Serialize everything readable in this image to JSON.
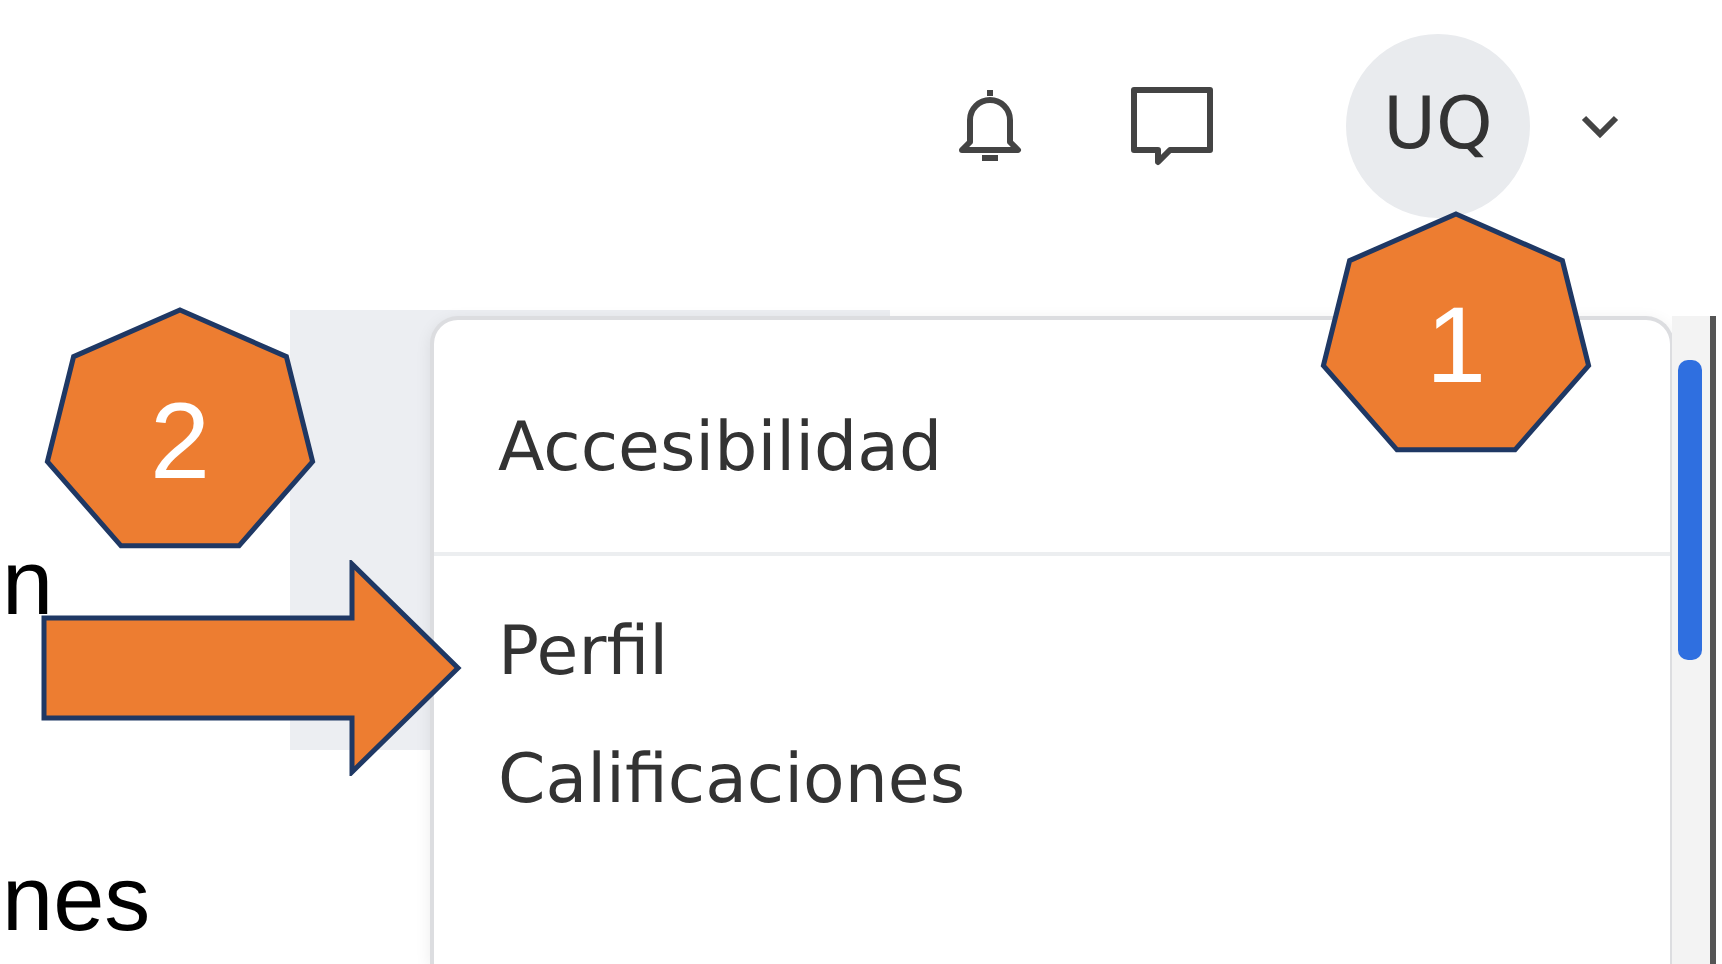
{
  "header": {
    "avatar_initials": "UQ"
  },
  "menu": {
    "items": [
      {
        "label": "Accesibilidad",
        "divider_after": true
      },
      {
        "label": "Perfil",
        "divider_after": false
      },
      {
        "label": "Calificaciones",
        "divider_after": false
      }
    ]
  },
  "background_text": [
    "n",
    "nes"
  ],
  "annotations": [
    {
      "kind": "badge",
      "label": "1"
    },
    {
      "kind": "badge",
      "label": "2"
    },
    {
      "kind": "arrow"
    }
  ]
}
